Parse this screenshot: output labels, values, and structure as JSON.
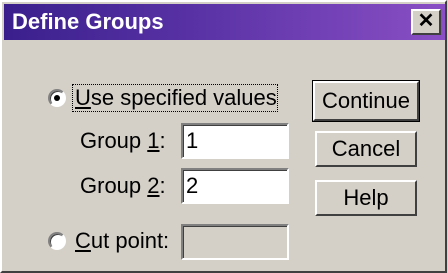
{
  "window": {
    "title": "Define Groups",
    "close_glyph": "✕"
  },
  "options": {
    "use_specified": {
      "label_prefix": "",
      "mnemonic": "U",
      "label_rest": "se specified values",
      "selected": true
    },
    "cut_point": {
      "label_prefix": "",
      "mnemonic": "C",
      "label_rest": "ut point:",
      "selected": false,
      "value": ""
    }
  },
  "groups": [
    {
      "label_prefix": "Group ",
      "mnemonic": "1",
      "label_suffix": ":",
      "value": "1"
    },
    {
      "label_prefix": "Group ",
      "mnemonic": "2",
      "label_suffix": ":",
      "value": "2"
    }
  ],
  "buttons": {
    "continue": "Continue",
    "cancel": "Cancel",
    "help": "Help"
  }
}
